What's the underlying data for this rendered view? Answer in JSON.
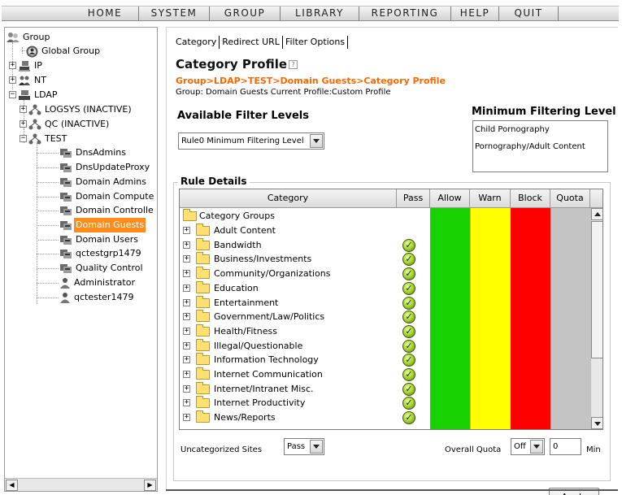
{
  "menu": [
    "HOME",
    "SYSTEM",
    "GROUP",
    "LIBRARY",
    "REPORTING",
    "HELP",
    "QUIT"
  ],
  "tree": {
    "root": "Group",
    "global": "Global Group",
    "ip": "IP",
    "nt": "NT",
    "ldap": "LDAP",
    "logsys": "LOGSYS (INACTIVE)",
    "qc": "QC (INACTIVE)",
    "test": "TEST",
    "groups": [
      "DnsAdmins",
      "DnsUpdateProxy",
      "Domain Admins",
      "Domain Compute",
      "Domain Controlle",
      "Domain Guests",
      "Domain Users",
      "qctestgrp1479",
      "Quality Control"
    ],
    "users": [
      "Administrator",
      "qctester1479"
    ],
    "selected": "Domain Guests"
  },
  "tabs": [
    "Category",
    "Redirect URL",
    "Filter Options"
  ],
  "page": {
    "title": "Category Profile",
    "breadcrumb": "Group>LDAP>TEST>Domain Guests>Category Profile",
    "group_info": "Group: Domain Guests   Current Profile:Custom Profile"
  },
  "filter_levels": {
    "heading": "Available Filter Levels",
    "selected": "Rule0 Minimum Filtering Level"
  },
  "min_filtering": {
    "heading": "Minimum Filtering Level",
    "items": [
      "Child Pornography",
      "Pornography/Adult Content"
    ]
  },
  "rule_details": {
    "legend": "Rule Details",
    "headers": [
      "Category",
      "Pass",
      "Allow",
      "Warn",
      "Block",
      "Quota"
    ],
    "group_header": "Category Groups",
    "rows": [
      {
        "name": "Adult Content",
        "pass": false
      },
      {
        "name": "Bandwidth",
        "pass": true
      },
      {
        "name": "Business/Investments",
        "pass": true
      },
      {
        "name": "Community/Organizations",
        "pass": true
      },
      {
        "name": "Education",
        "pass": true
      },
      {
        "name": "Entertainment",
        "pass": true
      },
      {
        "name": "Government/Law/Politics",
        "pass": true
      },
      {
        "name": "Health/Fitness",
        "pass": true
      },
      {
        "name": "Illegal/Questionable",
        "pass": true
      },
      {
        "name": "Information Technology",
        "pass": true
      },
      {
        "name": "Internet Communication",
        "pass": true
      },
      {
        "name": "Internet/Intranet Misc.",
        "pass": true
      },
      {
        "name": "Internet Productivity",
        "pass": true
      },
      {
        "name": "News/Reports",
        "pass": true
      }
    ],
    "colors": {
      "allow": "#17d100",
      "warn": "#ffff00",
      "block": "#ff0000",
      "quota": "#c4c4c4"
    }
  },
  "bottom": {
    "uncategorized_label": "Uncategorized Sites",
    "uncategorized_value": "Pass",
    "overall_quota_label": "Overall Quota",
    "overall_quota_value": "Off",
    "minutes_value": "0",
    "minutes_unit": "Min",
    "apply_label": "Apply"
  }
}
